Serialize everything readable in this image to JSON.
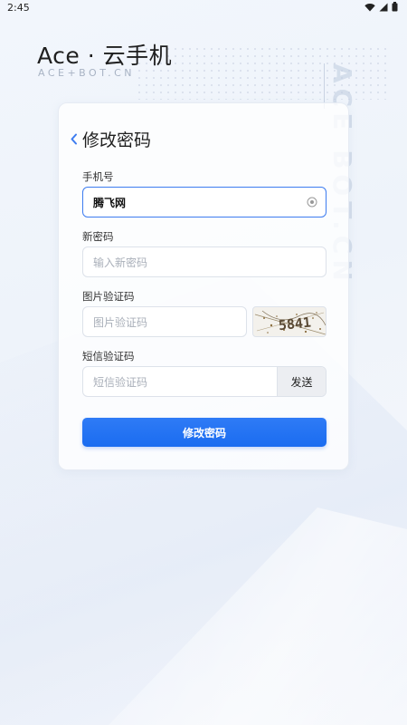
{
  "status_bar": {
    "time": "2:45"
  },
  "app": {
    "title": "Ace · 云手机",
    "subtitle": "ACE+BOT.CN",
    "watermark": "ACE BOT.CN"
  },
  "page": {
    "title": "修改密码"
  },
  "form": {
    "phone": {
      "label": "手机号",
      "value": "腾飞网"
    },
    "new_password": {
      "label": "新密码",
      "placeholder": "输入新密码"
    },
    "captcha": {
      "label": "图片验证码",
      "placeholder": "图片验证码",
      "image_text": "5841"
    },
    "sms": {
      "label": "短信验证码",
      "placeholder": "短信验证码",
      "send_label": "发送"
    },
    "submit_label": "修改密码"
  },
  "colors": {
    "accent": "#1a6cf0",
    "background": "#f2f6fc"
  },
  "icons": [
    "wifi-icon",
    "signal-icon",
    "battery-icon",
    "back-chevron-icon",
    "clear-input-icon"
  ]
}
